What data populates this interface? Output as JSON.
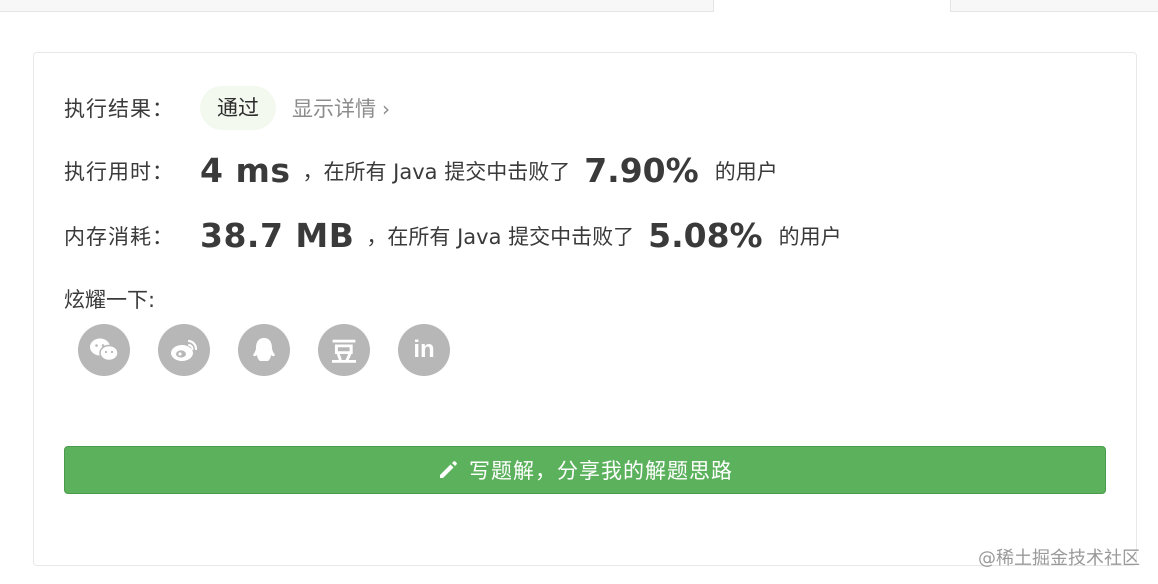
{
  "result": {
    "label": "执行结果：",
    "status": "通过",
    "details_link": "显示详情",
    "details_chevron": "›"
  },
  "runtime": {
    "label": "执行用时：",
    "value": "4 ms",
    "middle_text": "，在所有 Java 提交中击败了",
    "percent": "7.90%",
    "suffix": "的用户"
  },
  "memory": {
    "label": "内存消耗：",
    "value": "38.7 MB",
    "middle_text": "，在所有 Java 提交中击败了",
    "percent": "5.08%",
    "suffix": "的用户"
  },
  "share": {
    "label": "炫耀一下:",
    "icons": [
      "wechat-icon",
      "weibo-icon",
      "qq-icon",
      "douban-icon",
      "linkedin-icon"
    ],
    "douban_glyph": "豆",
    "linkedin_glyph": "in"
  },
  "write_solution_button": {
    "label": "写题解，分享我的解题思路",
    "icon": "pencil-icon"
  },
  "watermark": "@稀土掘金技术社区",
  "colors": {
    "accent_green": "#5cb15d",
    "pill_bg": "#f3f9ef",
    "icon_gray": "#b7b7b7"
  }
}
